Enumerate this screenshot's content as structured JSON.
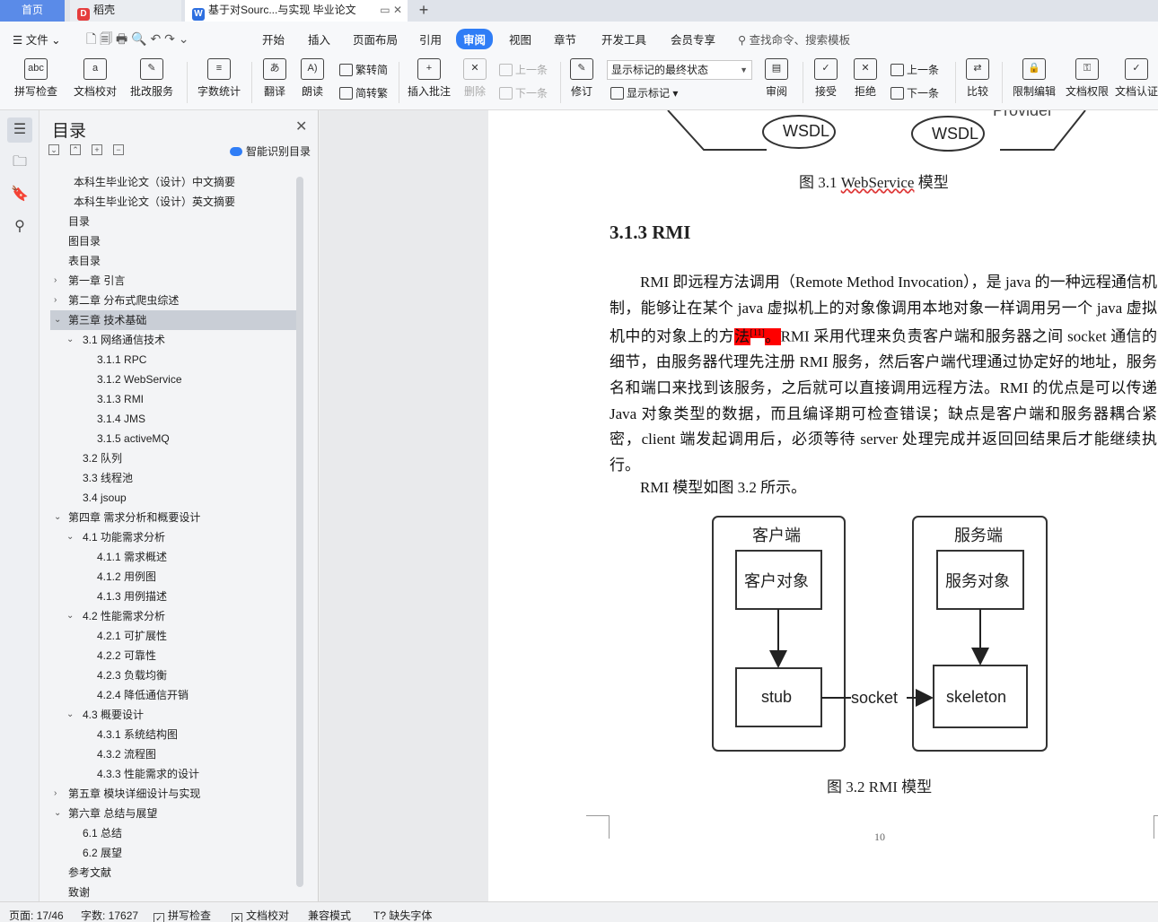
{
  "tabs": {
    "home": "首页",
    "daoke": "稻壳",
    "doc": "基于对Sourc...与实现 毕业论文"
  },
  "menu": {
    "file": "文件",
    "items": [
      "开始",
      "插入",
      "页面布局",
      "引用",
      "审阅",
      "视图",
      "章节",
      "开发工具",
      "会员专享"
    ],
    "search": "查找命令、搜索模板"
  },
  "ribbon": {
    "spell": "拼写检查",
    "proof": "文档校对",
    "batch": "批改服务",
    "wordcount": "字数统计",
    "translate": "翻译",
    "read": "朗读",
    "trad": "繁转简",
    "simp": "简转繁",
    "insert_comment": "插入批注",
    "delete": "删除",
    "prev": "上一条",
    "next": "下一条",
    "track": "修订",
    "markup_state": "显示标记的最终状态",
    "show_markup": "显示标记",
    "review": "审阅",
    "accept": "接受",
    "reject": "拒绝",
    "prev2": "上一条",
    "next2": "下一条",
    "compare": "比较",
    "restrict": "限制编辑",
    "perm": "文档权限",
    "auth": "文档认证"
  },
  "toc": {
    "title": "目录",
    "smart": "智能识别目录",
    "items": [
      {
        "text": "本科生毕业论文（设计）中文摘要",
        "level": 0,
        "arrow": ""
      },
      {
        "text": "本科生毕业论文（设计）英文摘要",
        "level": 0,
        "arrow": ""
      },
      {
        "text": "目录",
        "level": 0,
        "arrow": ""
      },
      {
        "text": "图目录",
        "level": 0,
        "arrow": ""
      },
      {
        "text": "表目录",
        "level": 0,
        "arrow": ""
      },
      {
        "text": "第一章 引言",
        "level": 0,
        "arrow": "›"
      },
      {
        "text": "第二章 分布式爬虫综述",
        "level": 0,
        "arrow": "›"
      },
      {
        "text": "第三章 技术基础",
        "level": 0,
        "arrow": "⌄"
      },
      {
        "text": "3.1 网络通信技术",
        "level": 1,
        "arrow": "⌄"
      },
      {
        "text": "3.1.1 RPC",
        "level": 2,
        "arrow": ""
      },
      {
        "text": "3.1.2 WebService",
        "level": 2,
        "arrow": ""
      },
      {
        "text": "3.1.3 RMI",
        "level": 2,
        "arrow": ""
      },
      {
        "text": "3.1.4 JMS",
        "level": 2,
        "arrow": ""
      },
      {
        "text": "3.1.5 activeMQ",
        "level": 2,
        "arrow": ""
      },
      {
        "text": "3.2 队列",
        "level": 1,
        "arrow": ""
      },
      {
        "text": "3.3 线程池",
        "level": 1,
        "arrow": ""
      },
      {
        "text": "3.4 jsoup",
        "level": 1,
        "arrow": ""
      },
      {
        "text": "第四章 需求分析和概要设计",
        "level": 0,
        "arrow": "⌄"
      },
      {
        "text": "4.1 功能需求分析",
        "level": 1,
        "arrow": "⌄"
      },
      {
        "text": "4.1.1 需求概述",
        "level": 2,
        "arrow": ""
      },
      {
        "text": "4.1.2 用例图",
        "level": 2,
        "arrow": ""
      },
      {
        "text": "4.1.3 用例描述",
        "level": 2,
        "arrow": ""
      },
      {
        "text": "4.2 性能需求分析",
        "level": 1,
        "arrow": "⌄"
      },
      {
        "text": "4.2.1 可扩展性",
        "level": 2,
        "arrow": ""
      },
      {
        "text": "4.2.2 可靠性",
        "level": 2,
        "arrow": ""
      },
      {
        "text": "4.2.3 负载均衡",
        "level": 2,
        "arrow": ""
      },
      {
        "text": "4.2.4 降低通信开销",
        "level": 2,
        "arrow": ""
      },
      {
        "text": "4.3 概要设计",
        "level": 1,
        "arrow": "⌄"
      },
      {
        "text": "4.3.1 系统结构图",
        "level": 2,
        "arrow": ""
      },
      {
        "text": "4.3.2 流程图",
        "level": 2,
        "arrow": ""
      },
      {
        "text": "4.3.3 性能需求的设计",
        "level": 2,
        "arrow": ""
      },
      {
        "text": "第五章 模块详细设计与实现",
        "level": 0,
        "arrow": "›"
      },
      {
        "text": "第六章 总结与展望",
        "level": 0,
        "arrow": "⌄"
      },
      {
        "text": "6.1 总结",
        "level": 1,
        "arrow": ""
      },
      {
        "text": "6.2 展望",
        "level": 1,
        "arrow": ""
      },
      {
        "text": "参考文献",
        "level": 0,
        "arrow": ""
      },
      {
        "text": "致谢",
        "level": 0,
        "arrow": ""
      }
    ],
    "selected_index": 7
  },
  "doc": {
    "fig31_wsdl_left": "WSDL",
    "fig31_wsdl_right": "WSDL",
    "fig31_provider": "Provider",
    "fig31_caption_pre": "图 3.1 ",
    "fig31_caption_word": "WebService",
    "fig31_caption_post": " 模型",
    "heading": "3.1.3 RMI",
    "para1_a": "RMI 即远程方法调用（Remote Method Invocation），是 java 的一种远程通信机制，能够让在某个 java 虚拟机上的对象像调用本地对象一样调用另一个 java 虚拟机中的对象上的方",
    "para1_hl": "法",
    "para1_ref": "[11]",
    "para1_hl2": "。",
    "para1_b": "RMI 采用代理来负责客户端和服务器之间 socket 通信的细节，由服务器代理先注册 RMI 服务，然后客户端代理通过协定好的地址，服务名和端口来找到该服务，之后就可以直接调用远程方法。RMI 的优点是可以传递 Java 对象类型的数据，而且编译期可检查错误；缺点是客户端和服务器耦合紧密，client 端发起调用后，必须等待 server 处理完成并返回回结果后才能继续执行。",
    "para2": "RMI 模型如图 3.2 所示。",
    "fig32": {
      "client": "客户端",
      "server": "服务端",
      "client_obj": "客户对象",
      "server_obj": "服务对象",
      "stub": "stub",
      "skeleton": "skeleton",
      "socket": "socket"
    },
    "fig32_caption": "图 3.2 RMI 模型",
    "page_number": "10"
  },
  "status": {
    "page": "页面: 17/46",
    "words": "字数: 17627",
    "spell": "拼写检查",
    "proof": "文档校对",
    "compat": "兼容模式",
    "missing_font": "缺失字体"
  },
  "colors": {
    "accent": "#2f7df6",
    "highlight": "#ff0000"
  }
}
